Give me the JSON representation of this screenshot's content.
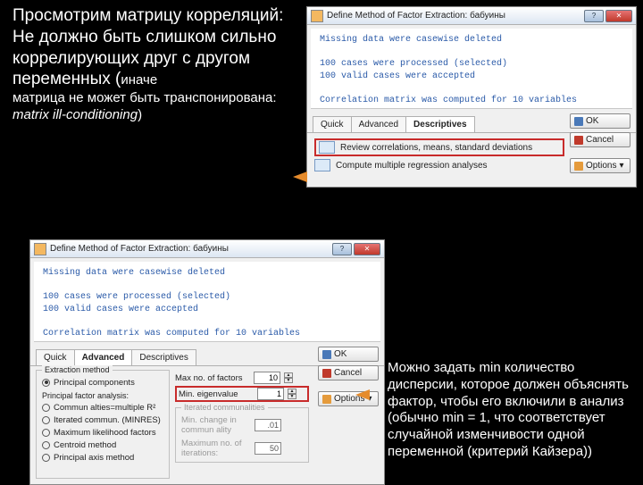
{
  "text_top": {
    "line1": "Просмотрим матрицу корреляций:",
    "line2": "Не должно быть слишком сильно коррелирующих друг с другом переменных (",
    "line2_tail": "иначе",
    "line3a": "матрица не может быть транспонирована: ",
    "line3b": "matrix ill-conditioning",
    "line3c": ")"
  },
  "text_right": "Можно задать min количество дисперсии, которое должен объяснять фактор, чтобы его включили в анализ (обычно min = 1, что соответствует случайной изменчивости одной переменной (критерий Кайзера))",
  "dlg": {
    "title": "Define Method of Factor Extraction: бабуины",
    "info": {
      "l1": "Missing data were casewise deleted",
      "l2": "100 cases were processed (selected)",
      "l3": "100 valid cases were accepted",
      "l4": "Correlation matrix was computed for 10 variables"
    },
    "tabs": {
      "quick": "Quick",
      "advanced": "Advanced",
      "descriptives": "Descriptives"
    },
    "buttons": {
      "ok": "OK",
      "cancel": "Cancel",
      "options": "Options"
    },
    "desc": {
      "row1": "Review correlations, means, standard deviations",
      "row2": "Compute multiple regression analyses"
    },
    "adv": {
      "extraction": "Extraction method",
      "r_principal": "Principal components",
      "pfa": "Principal factor analysis:",
      "r_comm": "Commun alties=multiple R²",
      "r_iter": "Iterated commun. (MINRES)",
      "r_maxlik": "Maximum likelihood factors",
      "r_centroid": "Centroid method",
      "r_paxis": "Principal axis method",
      "maxfactors": "Max no. of factors",
      "maxfactors_v": "10",
      "mineigen": "Min. eigenvalue",
      "mineigen_v": "1",
      "iterated": "Iterated communalities",
      "minchg": "Min. change in commun ality",
      "minchg_v": ".01",
      "maxiter": "Maximum no. of iterations:",
      "maxiter_v": "50"
    }
  }
}
